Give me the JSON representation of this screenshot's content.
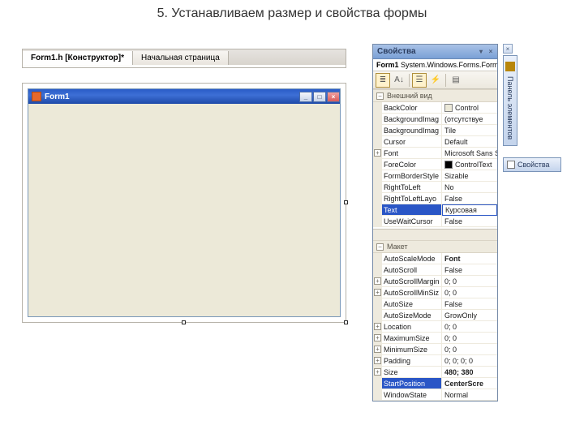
{
  "heading": "5. Устанавливаем размер и свойства формы",
  "tabs": {
    "active": "Form1.h [Конструктор]*",
    "inactive": "Начальная страница"
  },
  "form": {
    "title": "Form1",
    "buttons": {
      "min": "_",
      "max": "□",
      "close": "×"
    }
  },
  "props": {
    "panelTitle": "Свойства",
    "objectLabel": "Form1",
    "objectType": "System.Windows.Forms.Form",
    "toolbar": {
      "cat": "≣",
      "az": "A↓",
      "prop": "☰",
      "events": "⚡",
      "pages": "▤"
    },
    "cat1": "Внешний вид",
    "rows1": [
      {
        "k": "BackColor",
        "v": "Control",
        "swatch": "#ece9d8"
      },
      {
        "k": "BackgroundImag",
        "v": "(отсутствуе"
      },
      {
        "k": "BackgroundImag",
        "v": "Tile"
      },
      {
        "k": "Cursor",
        "v": "Default"
      },
      {
        "k": "Font",
        "v": "Microsoft Sans Se",
        "exp": true
      },
      {
        "k": "ForeColor",
        "v": "ControlText",
        "swatch": "#000000"
      },
      {
        "k": "FormBorderStyle",
        "v": "Sizable"
      },
      {
        "k": "RightToLeft",
        "v": "No"
      },
      {
        "k": "RightToLeftLayo",
        "v": "False"
      },
      {
        "k": "Text",
        "v": "Курсовая",
        "sel": true
      },
      {
        "k": "UseWaitCursor",
        "v": "False"
      }
    ],
    "cat2": "Макет",
    "rows2": [
      {
        "k": "AutoScaleMode",
        "v": "Font",
        "bold": true
      },
      {
        "k": "AutoScroll",
        "v": "False"
      },
      {
        "k": "AutoScrollMargin",
        "v": "0; 0",
        "exp": true
      },
      {
        "k": "AutoScrollMinSiz",
        "v": "0; 0",
        "exp": true
      },
      {
        "k": "AutoSize",
        "v": "False"
      },
      {
        "k": "AutoSizeMode",
        "v": "GrowOnly"
      },
      {
        "k": "Location",
        "v": "0; 0",
        "exp": true
      },
      {
        "k": "MaximumSize",
        "v": "0; 0",
        "exp": true
      },
      {
        "k": "MinimumSize",
        "v": "0; 0",
        "exp": true
      },
      {
        "k": "Padding",
        "v": "0; 0; 0; 0",
        "exp": true
      },
      {
        "k": "Size",
        "v": "480; 380",
        "exp": true,
        "bold": true
      },
      {
        "k": "StartPosition",
        "v": "CenterScre",
        "bold": true,
        "sel2": true
      },
      {
        "k": "WindowState",
        "v": "Normal"
      }
    ]
  },
  "side": {
    "close": "×",
    "toolbox": "Панель элементов",
    "propsTab": "Свойства"
  }
}
